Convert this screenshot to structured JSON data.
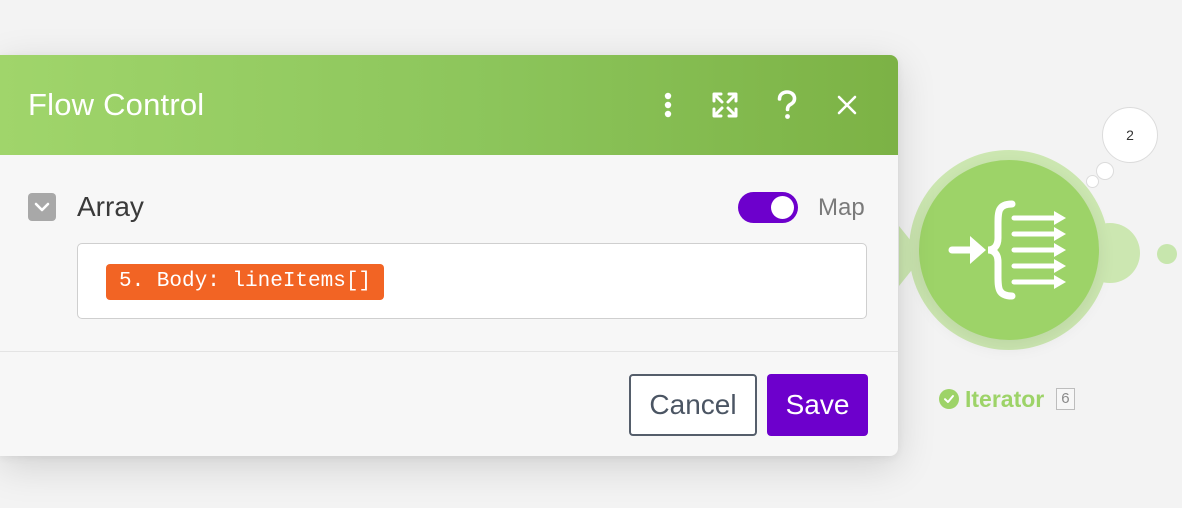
{
  "dialog": {
    "title": "Flow Control",
    "header_icons": [
      "more-vertical-icon",
      "expand-icon",
      "help-icon",
      "close-icon"
    ],
    "header_colors": {
      "start": "#a0d56b",
      "end": "#7cb245"
    }
  },
  "field": {
    "label": "Array",
    "map_toggle": {
      "label": "Map",
      "on": true,
      "color": "#6d00cc"
    },
    "value_pill": "5. Body: lineItems[]",
    "pill_color": "#f26424"
  },
  "buttons": {
    "cancel": "Cancel",
    "save": "Save",
    "save_color": "#6d00cc"
  },
  "module": {
    "name": "Iterator",
    "id": "6",
    "bubble_count": "2",
    "color": "#9dd368",
    "icon": "iterator-icon",
    "status_icon": "check-circle-icon"
  }
}
